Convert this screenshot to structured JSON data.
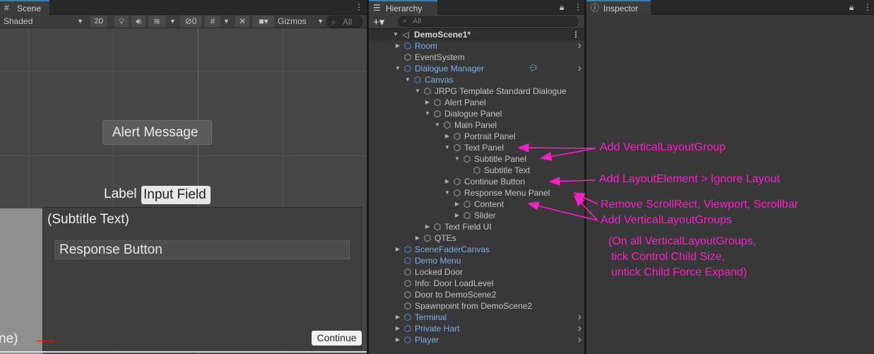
{
  "scene": {
    "tab_label": "Scene",
    "shading_mode": "Shaded",
    "btn_2d": "2D",
    "hidden_count": "0",
    "gizmos_label": "Gizmos",
    "search_placeholder": "All",
    "content": {
      "alert_message": "Alert Message",
      "label": "Label",
      "input_field": "Input Field",
      "subtitle_text": "(Subtitle Text)",
      "response_button": "Response Button",
      "portrait_text": "ne)",
      "continue_button": "Continue"
    }
  },
  "hierarchy": {
    "tab_label": "Hierarchy",
    "add_label": "+▾",
    "search_placeholder": "All",
    "scene_name": "DemoScene1*",
    "rows": [
      {
        "label": "Room",
        "blue": true
      },
      {
        "label": "EventSystem",
        "blue": false
      },
      {
        "label": "Dialogue Manager",
        "blue": true
      },
      {
        "label": "Canvas",
        "blue": true
      },
      {
        "label": "JRPG Template Standard Dialogue",
        "blue": false
      },
      {
        "label": "Alert Panel",
        "blue": false
      },
      {
        "label": "Dialogue Panel",
        "blue": false
      },
      {
        "label": "Main Panel",
        "blue": false
      },
      {
        "label": "Portrait Panel",
        "blue": false
      },
      {
        "label": "Text Panel",
        "blue": false
      },
      {
        "label": "Subtitle Panel",
        "blue": false
      },
      {
        "label": "Subtitle Text",
        "blue": false
      },
      {
        "label": "Continue Button",
        "blue": false
      },
      {
        "label": "Response Menu Panel",
        "blue": false
      },
      {
        "label": "Content",
        "blue": false
      },
      {
        "label": "Slider",
        "blue": false
      },
      {
        "label": "Text Field UI",
        "blue": false
      },
      {
        "label": "QTEs",
        "blue": false
      },
      {
        "label": "SceneFaderCanvas",
        "blue": true
      },
      {
        "label": "Demo Menu",
        "blue": true
      },
      {
        "label": "Locked Door",
        "blue": false
      },
      {
        "label": "Info: Door LoadLevel",
        "blue": false
      },
      {
        "label": "Door to DemoScene2",
        "blue": false
      },
      {
        "label": "Spawnpoint from DemoScene2",
        "blue": false
      },
      {
        "label": "Terminal",
        "blue": true
      },
      {
        "label": "Private Hart",
        "blue": true
      },
      {
        "label": "Player",
        "blue": true
      }
    ]
  },
  "inspector": {
    "tab_label": "Inspector"
  },
  "annotations": {
    "text_panel": "Add VerticalLayoutGroup",
    "continue_button": "Add LayoutElement > Ignore Layout",
    "response_remove": "Remove ScrollRect, Viewport, Scrollbar",
    "response_add": "Add VerticalLayoutGroups",
    "note_line1": "(On all VerticalLayoutGroups,",
    "note_line2": "tick Control Child Size,",
    "note_line3": "untick Child Force Expand)"
  },
  "colors": {
    "annotation": "#ff1fc7",
    "prefab_blue": "#7bb1f2",
    "tab_accent": "#3a79bb"
  }
}
